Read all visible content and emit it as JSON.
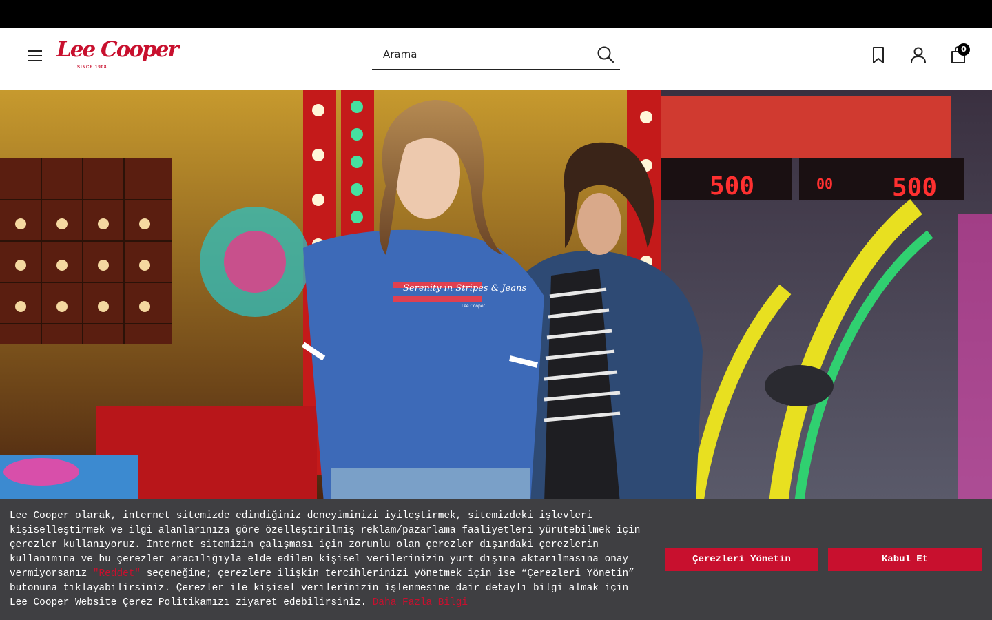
{
  "header": {
    "logo_text": "Lee Cooper",
    "logo_sub": "SINCE 1908",
    "search_placeholder": "Arama",
    "cart_count": "0"
  },
  "hero": {
    "tshirt_print": "Serenity in Stripes & Jeans",
    "tshirt_brand": "Lee Cooper",
    "score_left": "500",
    "score_right": "500",
    "score_small": "00"
  },
  "cookie_banner": {
    "text_before": "Lee Cooper olarak, internet sitemizde edindiğiniz deneyiminizi iyileştirmek, sitemizdeki işlevleri kişiselleştirmek ve ilgi alanlarınıza göre özelleştirilmiş reklam/pazarlama faaliyetleri yürütebilmek için çerezler kullanıyoruz. İnternet sitemizin çalışması için zorunlu olan çerezler dışındaki çerezlerin kullanımına ve bu çerezler aracılığıyla elde edilen kişisel verilerinizin yurt dışına aktarılmasına onay vermiyorsanız ",
    "reject_word": "\"Reddet\"",
    "text_after": " seçeneğine; çerezlere ilişkin tercihlerinizi yönetmek için ise “Çerezleri Yönetin” butonuna tıklayabilirsiniz. Çerezler ile kişisel verilerinizin işlenmesine dair detaylı bilgi almak için Lee Cooper Website Çerez Politikamızı ziyaret edebilirsiniz. ",
    "more_link": "Daha Fazla Bilgi",
    "manage_button": "Çerezleri Yönetin",
    "accept_button": "Kabul Et"
  },
  "colors": {
    "brand_red": "#c8102e",
    "banner_bg": "#3f3f42",
    "top_bar": "#000000"
  }
}
